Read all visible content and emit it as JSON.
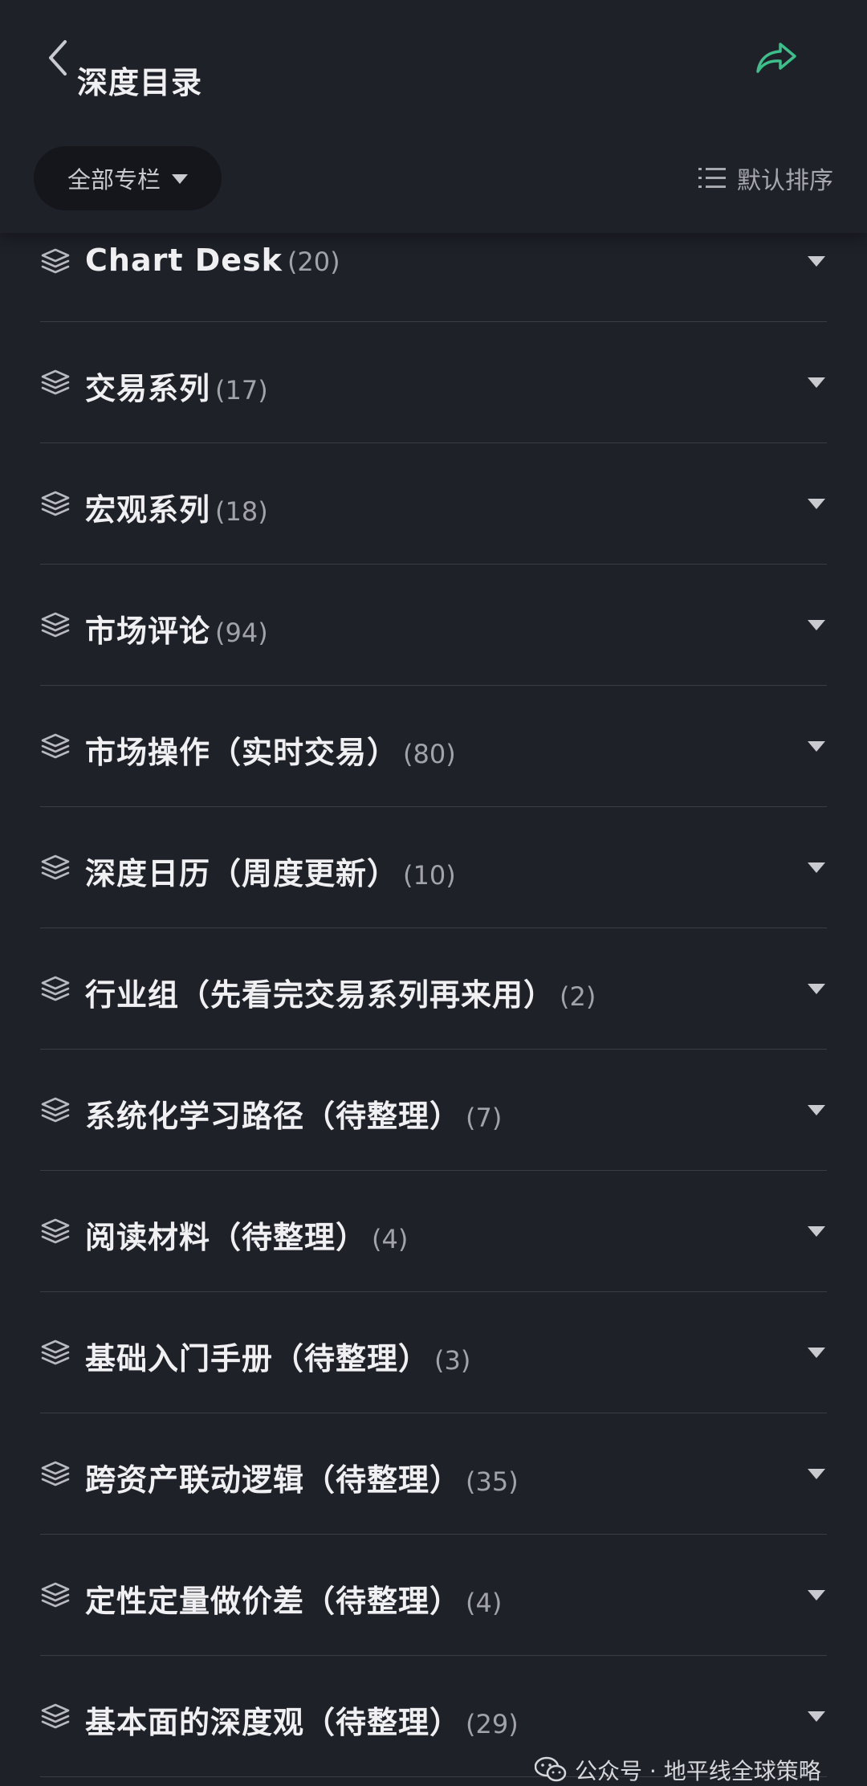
{
  "header": {
    "title": "深度目录",
    "back_icon": "chevron-left-icon",
    "share_icon": "share-arrow-icon",
    "share_color": "#3dbf8a"
  },
  "toolbar": {
    "filter_label": "全部专栏",
    "sort_label": "默认排序"
  },
  "items": [
    {
      "title": "Chart Desk",
      "count": "(20)"
    },
    {
      "title": "交易系列",
      "count": "(17)"
    },
    {
      "title": "宏观系列",
      "count": "(18)"
    },
    {
      "title": "市场评论",
      "count": "(94)"
    },
    {
      "title": "市场操作（实时交易）",
      "count": "(80)"
    },
    {
      "title": "深度日历（周度更新）",
      "count": "(10)"
    },
    {
      "title": "行业组（先看完交易系列再来用）",
      "count": "(2)"
    },
    {
      "title": "系统化学习路径（待整理）",
      "count": "(7)"
    },
    {
      "title": "阅读材料（待整理）",
      "count": "(4)"
    },
    {
      "title": "基础入门手册（待整理）",
      "count": "(3)"
    },
    {
      "title": "跨资产联动逻辑（待整理）",
      "count": "(35)"
    },
    {
      "title": "定性定量做价差（待整理）",
      "count": "(4)"
    },
    {
      "title": "基本面的深度观（待整理）",
      "count": "(29)"
    }
  ],
  "watermark": {
    "text": "公众号 · 地平线全球策略"
  }
}
